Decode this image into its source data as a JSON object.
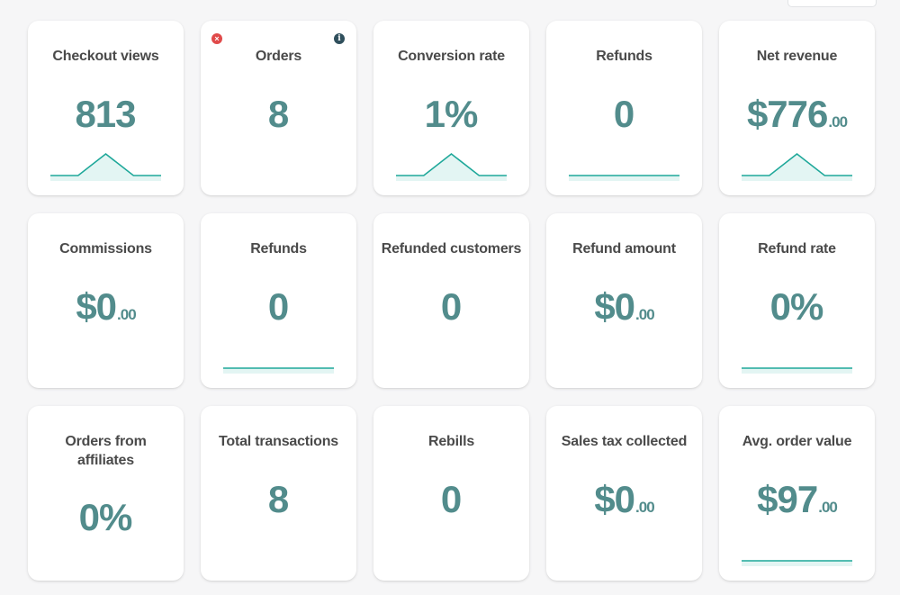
{
  "colors": {
    "value": "#528c8c",
    "title": "#4a4a4a",
    "sparkline_stroke": "#1fa89a",
    "sparkline_fill": "#e3f5f3",
    "close_icon": "#e04a4a",
    "info_icon": "#2f4f5c"
  },
  "icons": {
    "close": "×",
    "info": "i"
  },
  "cards": [
    {
      "key": "checkout-views",
      "title": "Checkout views",
      "value": "813",
      "cents": "",
      "sparkline": [
        0,
        0,
        1,
        0,
        0
      ]
    },
    {
      "key": "orders",
      "title": "Orders",
      "value": "8",
      "cents": "",
      "sparkline": null
    },
    {
      "key": "conversion-rate",
      "title": "Conversion rate",
      "value": "1%",
      "cents": "",
      "sparkline": [
        0,
        0,
        1,
        0,
        0
      ]
    },
    {
      "key": "refunds",
      "title": "Refunds",
      "value": "0",
      "cents": "",
      "sparkline": [
        0,
        0,
        0,
        0,
        0
      ]
    },
    {
      "key": "net-revenue",
      "title": "Net revenue",
      "value": "$776",
      "cents": ".00",
      "sparkline": [
        0,
        0,
        1,
        0,
        0
      ]
    },
    {
      "key": "commissions",
      "title": "Commissions",
      "value": "$0",
      "cents": ".00",
      "sparkline": null
    },
    {
      "key": "refunds-2",
      "title": "Refunds",
      "value": "0",
      "cents": "",
      "sparkline": [
        0,
        0,
        0,
        0,
        0
      ]
    },
    {
      "key": "refunded-customers",
      "title": "Refunded customers",
      "value": "0",
      "cents": "",
      "sparkline": null
    },
    {
      "key": "refund-amount",
      "title": "Refund amount",
      "value": "$0",
      "cents": ".00",
      "sparkline": null
    },
    {
      "key": "refund-rate",
      "title": "Refund rate",
      "value": "0%",
      "cents": "",
      "sparkline": [
        0,
        0,
        0,
        0,
        0
      ]
    },
    {
      "key": "orders-from-affiliates",
      "title": "Orders from affiliates",
      "value": "0%",
      "cents": "",
      "sparkline": null
    },
    {
      "key": "total-transactions",
      "title": "Total transactions",
      "value": "8",
      "cents": "",
      "sparkline": null
    },
    {
      "key": "rebills",
      "title": "Rebills",
      "value": "0",
      "cents": "",
      "sparkline": null
    },
    {
      "key": "sales-tax-collected",
      "title": "Sales tax collected",
      "value": "$0",
      "cents": ".00",
      "sparkline": null
    },
    {
      "key": "avg-order-value",
      "title": "Avg. order value",
      "value": "$97",
      "cents": ".00",
      "sparkline": [
        0,
        0,
        0,
        0,
        0
      ]
    }
  ]
}
